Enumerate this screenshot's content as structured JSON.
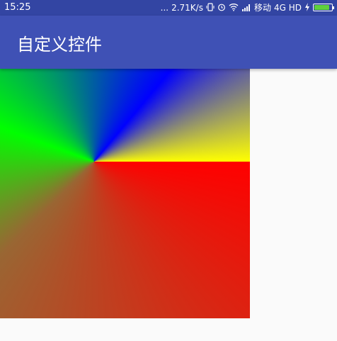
{
  "status_bar": {
    "time": "15:25",
    "more": "...",
    "speed": "2.71K/s",
    "carrier": "移动",
    "network": "4G HD",
    "battery_level": 0.9,
    "battery_color": "#5fd13c"
  },
  "app_bar": {
    "title": "自定义控件",
    "color": "#3f51b5"
  },
  "custom_view": {
    "colors": [
      "#ff0000",
      "#996633",
      "#00ff00",
      "#0000ff",
      "#ffff00"
    ]
  }
}
